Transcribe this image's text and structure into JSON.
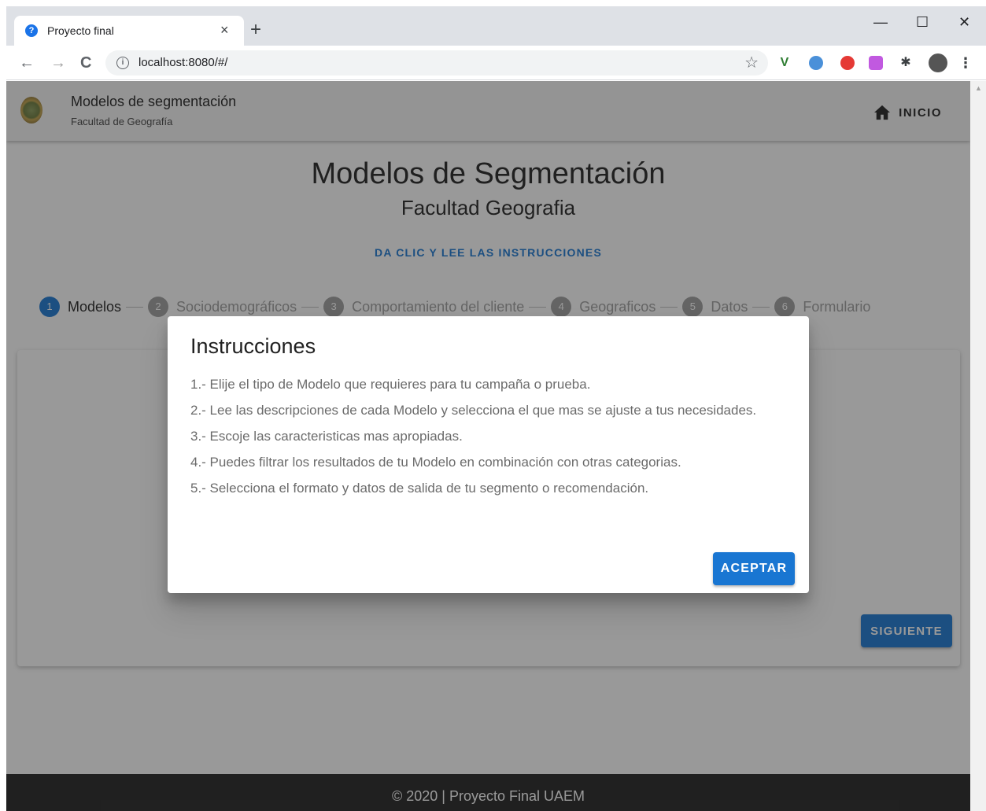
{
  "browser": {
    "tab_title": "Proyecto final",
    "tab_favicon": "?",
    "tab_close": "×",
    "new_tab": "+",
    "url": "localhost:8080/#/",
    "back": "←",
    "forward": "→",
    "reload": "C",
    "info": "i",
    "bookmark": "☆",
    "minimize": "—",
    "maximize": "☐",
    "close": "✕",
    "extensions_menu": "⋮"
  },
  "app": {
    "title": "Modelos de segmentación",
    "subtitle": "Facultad de Geografía",
    "home_label": "INICIO"
  },
  "page": {
    "title": "Modelos de Segmentación",
    "subtitle": "Facultad Geografia",
    "instructions_link": "DA CLIC Y LEE LAS INSTRUCCIONES"
  },
  "stepper": {
    "steps": [
      {
        "num": "1",
        "label": "Modelos"
      },
      {
        "num": "2",
        "label": "Sociodemográficos"
      },
      {
        "num": "3",
        "label": "Comportamiento del cliente"
      },
      {
        "num": "4",
        "label": "Geograficos"
      },
      {
        "num": "5",
        "label": "Datos"
      },
      {
        "num": "6",
        "label": "Formulario"
      }
    ]
  },
  "card": {
    "next_label": "SIGUIENTE"
  },
  "footer": {
    "text": "© 2020 | Proyecto Final UAEM"
  },
  "dialog": {
    "title": "Instrucciones",
    "lines": [
      "1.- Elije el tipo de Modelo que requieres para tu campaña o prueba.",
      "2.- Lee las descripciones de cada Modelo y selecciona el que mas se ajuste a tus necesidades.",
      "3.- Escoje las caracteristicas mas apropiadas.",
      "4.- Puedes filtrar los resultados de tu Modelo en combinación con otras categorias.",
      "5.- Selecciona el formato y datos de salida de tu segmento o recomendación."
    ],
    "accept_label": "ACEPTAR"
  },
  "colors": {
    "primary": "#1976d2",
    "footer_bg": "#212121",
    "appbar_bg": "#f5f5f5",
    "overlay": "rgba(33,33,33,0.46)"
  }
}
